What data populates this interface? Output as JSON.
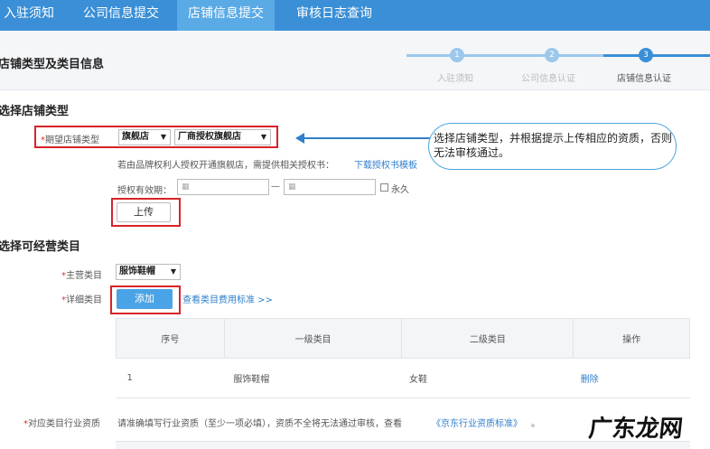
{
  "nav": {
    "items": [
      {
        "label": "入驻须知"
      },
      {
        "label": "公司信息提交"
      },
      {
        "label": "店铺信息提交"
      },
      {
        "label": "审核日志查询"
      }
    ]
  },
  "header": {
    "title": "店铺类型及类目信息",
    "steps": [
      {
        "number": "1",
        "label": "入驻须知"
      },
      {
        "number": "2",
        "label": "公司信息认证"
      },
      {
        "number": "3",
        "label": "店铺信息认证"
      }
    ]
  },
  "store_type": {
    "section_title": "选择店铺类型",
    "label_required": "*",
    "label": "期望店铺类型",
    "select1": "旗舰店",
    "select2": "厂商授权旗舰店",
    "notice": "若由品牌权利人授权开通旗舰店，需提供相关授权书：",
    "download_link": "下载授权书模板",
    "validity_label": "授权有效期：",
    "date_dash": "—",
    "permanent_label": "永久",
    "upload_button": "上传"
  },
  "callout": {
    "text": "选择店铺类型，并根据提示上传相应的资质，否则无法审核通过。"
  },
  "category": {
    "section_title": "选择可经营类目",
    "main_label_required": "*",
    "main_label": "主营类目",
    "main_select": "服饰鞋帽",
    "detail_label_required": "*",
    "detail_label": "详细类目",
    "add_button": "添加",
    "fee_link": "查看类目费用标准 >>",
    "table": {
      "headers": [
        "序号",
        "一级类目",
        "二级类目",
        "操作"
      ],
      "rows": [
        {
          "index": "1",
          "level1": "服饰鞋帽",
          "level2": "女鞋",
          "action": "删除"
        }
      ]
    },
    "qualification_required": "*",
    "qualification_label": "对应类目行业资质",
    "qualification_text": "请准确填写行业资质（至少一项必填），资质不全将无法通过审核，查看",
    "qualification_link": "《京东行业资质标准》",
    "qualification_end": "。"
  },
  "watermark": "广东龙网",
  "colors": {
    "nav_bg": "#3a8fd6",
    "highlight_red": "#d8232a",
    "link_blue": "#2f7fcc",
    "button_blue": "#4aa3e6"
  }
}
